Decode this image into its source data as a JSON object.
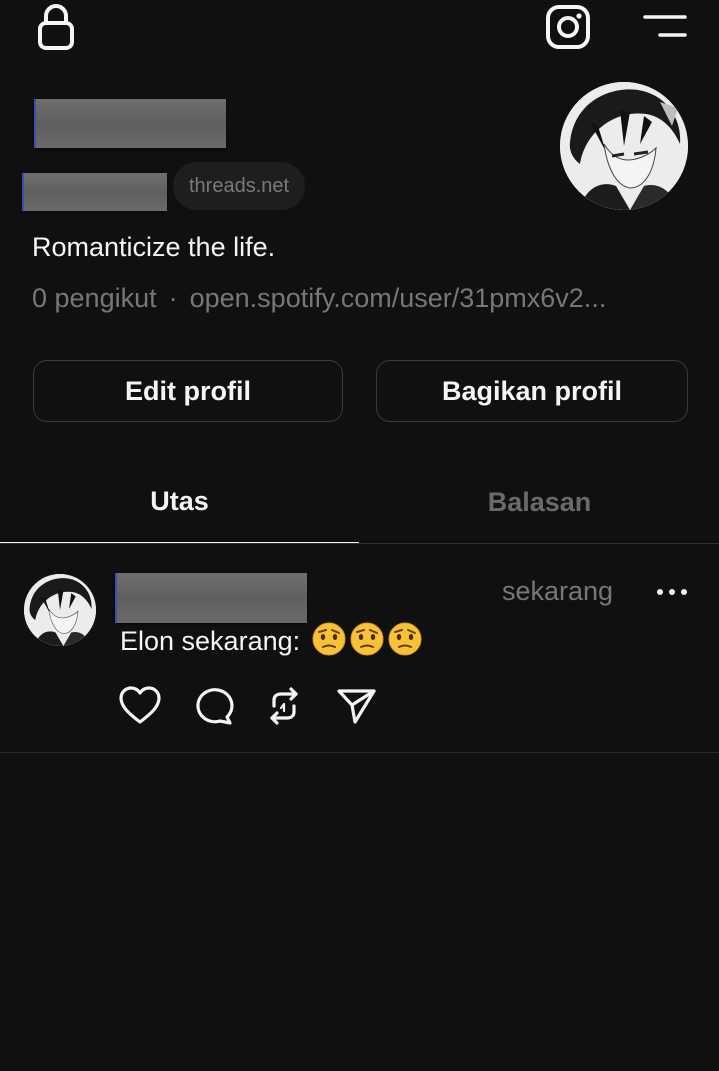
{
  "topbar": {
    "left_icon": "lock-icon",
    "right_icons": [
      "instagram-icon",
      "menu-icon"
    ]
  },
  "profile": {
    "domain": "threads.net",
    "bio": "Romanticize the life.",
    "followers": "0 pengikut",
    "separator": "·",
    "link": "open.spotify.com/user/31pmx6v2..."
  },
  "buttons": {
    "edit": "Edit profil",
    "share": "Bagikan profil"
  },
  "tabs": [
    {
      "label": "Utas",
      "active": true
    },
    {
      "label": "Balasan",
      "active": false
    }
  ],
  "post": {
    "time": "sekarang",
    "text": "Elon sekarang:",
    "emoji_name": "face-with-raised-eyebrow",
    "emoji_count": 3,
    "actions": [
      "heart-icon",
      "comment-icon",
      "repost-icon",
      "send-icon"
    ]
  },
  "colors": {
    "background": "#101010",
    "text": "#f3f5f7",
    "muted": "#777777",
    "border": "#3a3a3a",
    "emoji": "#f7c23a"
  }
}
